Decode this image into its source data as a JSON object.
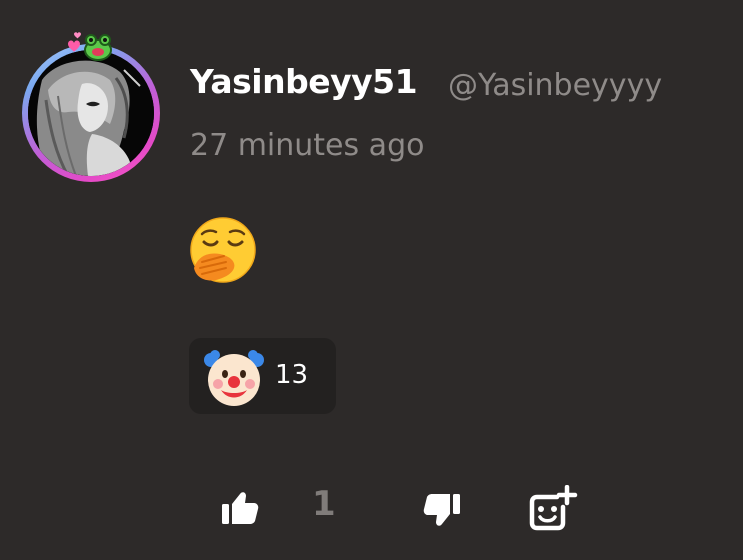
{
  "comment": {
    "author": {
      "display_name": "Yasinbeyy51",
      "handle": "@Yasinbeyyyy",
      "avatar_icon": "anime-avatar",
      "avatar_decoration_icon": "frog-hearts-icon",
      "avatar_ring_colors": [
        "#b0d0ff",
        "#c05fd6",
        "#ff5cc8"
      ]
    },
    "timestamp": "27 minutes ago",
    "message_emoji": "yawning-face-emoji"
  },
  "reactions": [
    {
      "emoji": "clown-face-emoji",
      "count": "13"
    }
  ],
  "actions": {
    "like_icon": "thumbs-up-icon",
    "like_count": "1",
    "dislike_icon": "thumbs-down-icon",
    "add_reaction_icon": "add-emoji-icon"
  },
  "colors": {
    "background": "#2d2a29",
    "chip_background": "#232120",
    "muted_text": "#8f8b89",
    "icon_color": "#ffffff"
  }
}
